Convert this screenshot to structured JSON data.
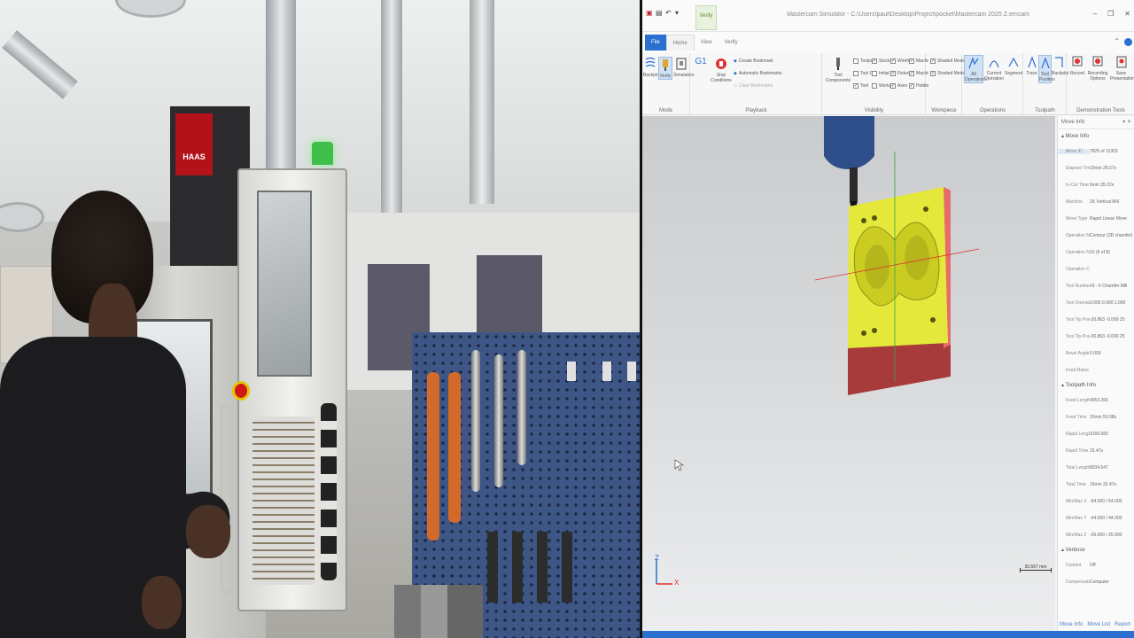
{
  "camera": {
    "machine_logo": "HAAS"
  },
  "app": {
    "window_title": "Mastercam Simulator - C:\\Users\\paul\\Desktop\\Project\\pocket\\Mastercam 2025 Z.emcam",
    "context_tab": "Verify",
    "tabs": [
      "File",
      "Home",
      "View",
      "Verify"
    ],
    "active_tab": "Home",
    "ribbon": {
      "mode": {
        "label": "Mode",
        "buttons": [
          "Backplot",
          "Verify",
          "Simulation"
        ]
      },
      "playback": {
        "label": "Playback",
        "buttons": [
          "G1",
          "Stop Conditions"
        ],
        "options": [
          "Create Bookmark",
          "Automatic Bookmarks",
          "Clear Bookmarks"
        ]
      },
      "visibility": {
        "label": "Visibility",
        "tool_button": "Tool Components",
        "checks": [
          {
            "label": "Toolpath",
            "checked": false
          },
          {
            "label": "Tool Contact Point",
            "checked": false
          },
          {
            "label": "Tool",
            "checked": true
          },
          {
            "label": "Stock",
            "checked": true
          },
          {
            "label": "Initial Stock",
            "checked": false
          },
          {
            "label": "Workpiece",
            "checked": false
          },
          {
            "label": "Wireframe",
            "checked": true
          },
          {
            "label": "Fixtures",
            "checked": true
          },
          {
            "label": "Axes",
            "checked": true
          },
          {
            "label": "Machine",
            "checked": true
          },
          {
            "label": "Machine Housing",
            "checked": true
          },
          {
            "label": "Holders",
            "checked": true
          }
        ]
      },
      "workpiece": {
        "label": "Workpiece",
        "checks": [
          {
            "label": "Shaded Model",
            "checked": true
          },
          {
            "label": "Shaded Model",
            "checked": true
          }
        ]
      },
      "operations": {
        "label": "Operations",
        "buttons": [
          "All Operations",
          "Current Operation",
          "Segment"
        ]
      },
      "toolpath": {
        "label": "Toolpath",
        "buttons": [
          "Trace",
          "Tool Position",
          "Backplot"
        ]
      },
      "demonstration": {
        "label": "Demonstration Tools",
        "buttons": [
          "Record",
          "Recording Options",
          "Save Presentation"
        ]
      }
    },
    "viewport": {
      "scale_label": "30.567 mm",
      "axis_z": "Z",
      "axis_x": "X"
    },
    "panel": {
      "title": "Move Info",
      "sections": [
        {
          "title": "Move Info",
          "rows": [
            {
              "k": "Move ID",
              "v": "7825 of 11303"
            },
            {
              "k": "Elapsed Time",
              "v": "15min 28.57s"
            },
            {
              "k": "In-Cut Time",
              "v": "6min 35.22s"
            },
            {
              "k": "Machine",
              "v": "3X Vertical Mill"
            },
            {
              "k": "Move Type",
              "v": "Rapid Linear Move"
            },
            {
              "k": "Operation Na...",
              "v": "Contour (3D chamfer)"
            },
            {
              "k": "Operation Nu...",
              "v": "10 (6 of 8)"
            },
            {
              "k": "Operation Co...",
              "v": ""
            },
            {
              "k": "Tool Number",
              "v": "#3 - 6 Chamfer Mill"
            },
            {
              "k": "Tool Orientati...",
              "v": "0.000 0.000 1.000"
            },
            {
              "k": "Tool Tip Positi...",
              "v": "-30.863 -0.000 25"
            },
            {
              "k": "Tool Tip Positi...",
              "v": "-30.863 -0.000 25"
            },
            {
              "k": "Bevel Angle",
              "v": "0.000"
            },
            {
              "k": "Feed Rates",
              "v": ""
            }
          ]
        },
        {
          "title": "Toolpath Info",
          "rows": [
            {
              "k": "Feed Length",
              "v": "4953.266"
            },
            {
              "k": "Feed Time",
              "v": "15min 50.08s"
            },
            {
              "k": "Rapid Length",
              "v": "3166.565"
            },
            {
              "k": "Rapid Time",
              "v": "15.47s"
            },
            {
              "k": "Total Length",
              "v": "8034.647"
            },
            {
              "k": "Total Time",
              "v": "16min 32.47s"
            },
            {
              "k": "Min/Max X",
              "v": "-94.000 / 54.000"
            },
            {
              "k": "Min/Max Y",
              "v": "-44.000 / 44.000"
            },
            {
              "k": "Min/Max Z",
              "v": "-26.000 / 25.000"
            }
          ]
        },
        {
          "title": "Verbose",
          "rows": [
            {
              "k": "Coolant",
              "v": "Off"
            },
            {
              "k": "Compensatio...",
              "v": "Computer"
            }
          ]
        }
      ],
      "bottom_tabs": [
        "Move Info",
        "Move List",
        "Report"
      ]
    }
  }
}
